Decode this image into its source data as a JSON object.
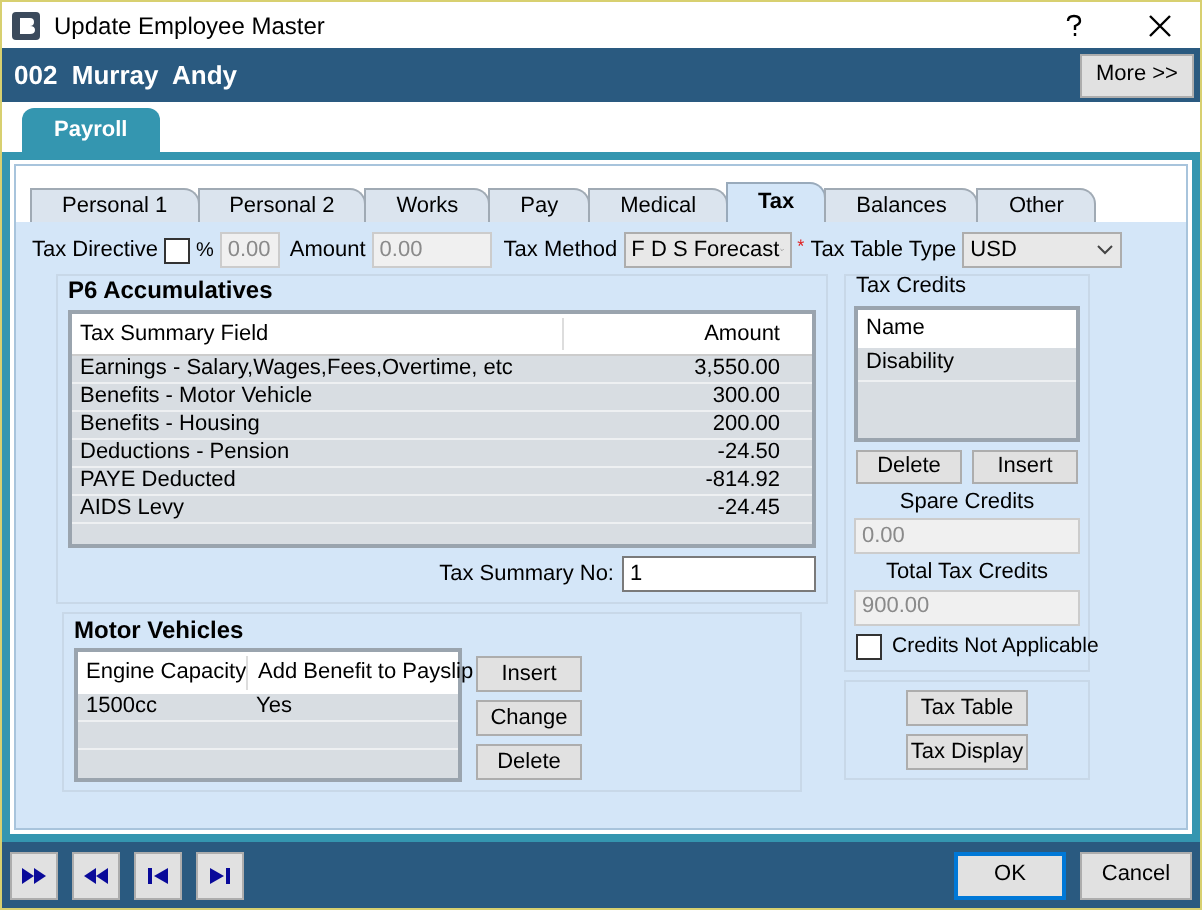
{
  "window": {
    "title": "Update Employee Master"
  },
  "header": {
    "employee": "002  Murray  Andy",
    "more_button": "More >>"
  },
  "top_tabs": [
    {
      "label": "Payroll",
      "selected": true
    }
  ],
  "tabs": [
    {
      "label": "Personal 1",
      "selected": false
    },
    {
      "label": "Personal 2",
      "selected": false
    },
    {
      "label": "Works",
      "selected": false
    },
    {
      "label": "Pay",
      "selected": false
    },
    {
      "label": "Medical",
      "selected": false
    },
    {
      "label": "Tax",
      "selected": true
    },
    {
      "label": "Balances",
      "selected": false
    },
    {
      "label": "Other",
      "selected": false
    }
  ],
  "tax_directive": {
    "label": "Tax Directive",
    "checked": false,
    "percent_label": "%",
    "percent_value": "0.00",
    "amount_label": "Amount",
    "amount_value": "0.00"
  },
  "tax_method": {
    "label": "Tax Method",
    "value": "F D S Forecast"
  },
  "tax_table_type": {
    "required_mark": "*",
    "label": "Tax Table Type",
    "value": "USD"
  },
  "p6": {
    "title": "P6 Accumulatives",
    "columns": [
      "Tax Summary Field",
      "Amount"
    ],
    "rows": [
      [
        "Earnings - Salary,Wages,Fees,Overtime, etc",
        "3,550.00"
      ],
      [
        "Benefits - Motor Vehicle",
        "300.00"
      ],
      [
        "Benefits - Housing",
        "200.00"
      ],
      [
        "Deductions - Pension",
        "-24.50"
      ],
      [
        "PAYE Deducted",
        "-814.92"
      ],
      [
        "AIDS Levy",
        "-24.45"
      ]
    ],
    "summary_no_label": "Tax Summary No:",
    "summary_no_value": "1"
  },
  "motor_vehicles": {
    "title": "Motor Vehicles",
    "columns": [
      "Engine Capacity",
      "Add Benefit to Payslip"
    ],
    "rows": [
      [
        "1500cc",
        "Yes"
      ]
    ],
    "buttons": [
      "Insert",
      "Change",
      "Delete"
    ]
  },
  "tax_credits": {
    "title": "Tax Credits",
    "column": "Name",
    "rows": [
      "Disability"
    ],
    "buttons": [
      "Delete",
      "Insert"
    ],
    "spare_label": "Spare Credits",
    "spare_value": "0.00",
    "total_label": "Total Tax Credits",
    "total_value": "900.00",
    "not_applicable": {
      "label": "Credits Not Applicable",
      "checked": false
    }
  },
  "tax_buttons": [
    "Tax Table",
    "Tax Display"
  ],
  "nav_buttons": [
    {
      "kind": "forward"
    },
    {
      "kind": "back"
    },
    {
      "kind": "first"
    },
    {
      "kind": "last"
    }
  ],
  "footer_buttons": [
    {
      "label": "OK",
      "default": true
    },
    {
      "label": "Cancel",
      "default": false
    }
  ]
}
